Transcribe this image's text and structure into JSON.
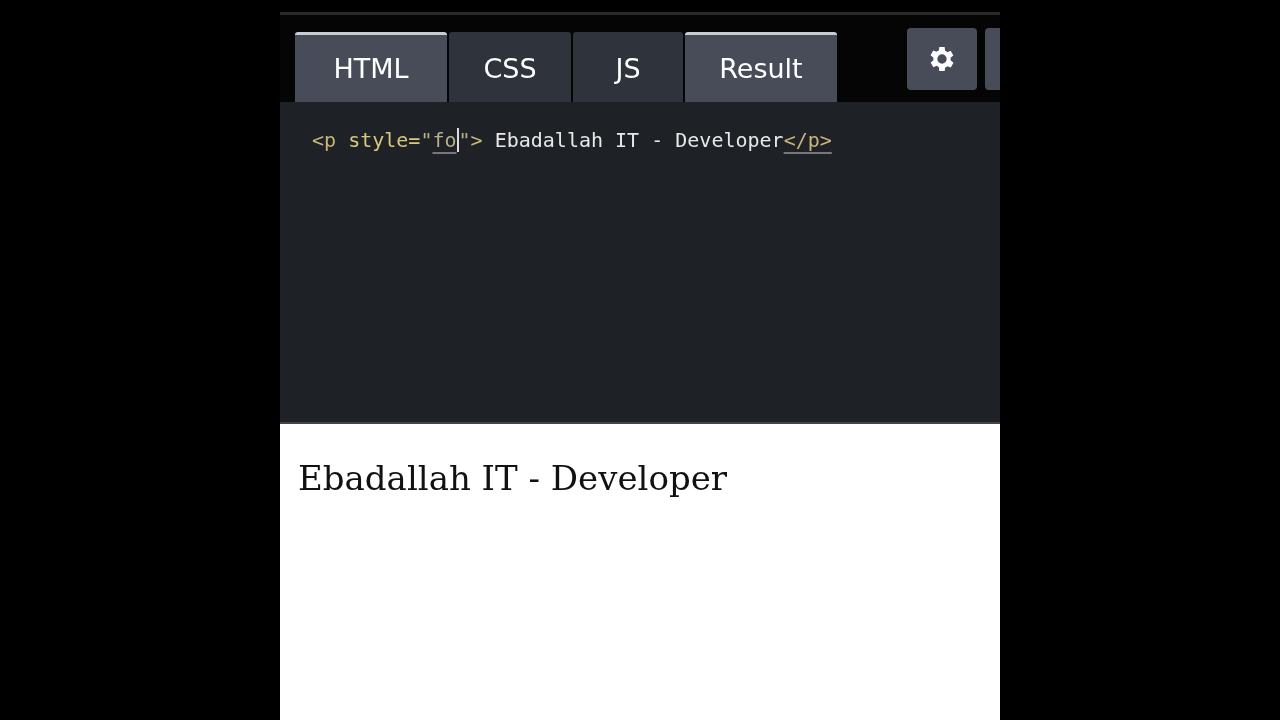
{
  "tabs": [
    {
      "label": "HTML",
      "selected": true
    },
    {
      "label": "CSS",
      "selected": false
    },
    {
      "label": "JS",
      "selected": false
    },
    {
      "label": "Result",
      "selected": true
    }
  ],
  "editor": {
    "tokens": [
      {
        "kind": "tag",
        "text": "<p ",
        "underlined": false,
        "cursor_after": false
      },
      {
        "kind": "attr",
        "text": "style=",
        "underlined": false,
        "cursor_after": false
      },
      {
        "kind": "string",
        "text": "\"",
        "underlined": false,
        "cursor_after": false
      },
      {
        "kind": "string",
        "text": "fo",
        "underlined": true,
        "cursor_after": true
      },
      {
        "kind": "string",
        "text": "\"",
        "underlined": false,
        "cursor_after": false
      },
      {
        "kind": "tag",
        "text": "> ",
        "underlined": false,
        "cursor_after": false
      },
      {
        "kind": "text",
        "text": "Ebadallah IT - Developer",
        "underlined": false,
        "cursor_after": false
      },
      {
        "kind": "tag",
        "text": "</p>",
        "underlined": true,
        "cursor_after": false
      }
    ]
  },
  "result": {
    "text": "Ebadallah IT - Developer"
  }
}
